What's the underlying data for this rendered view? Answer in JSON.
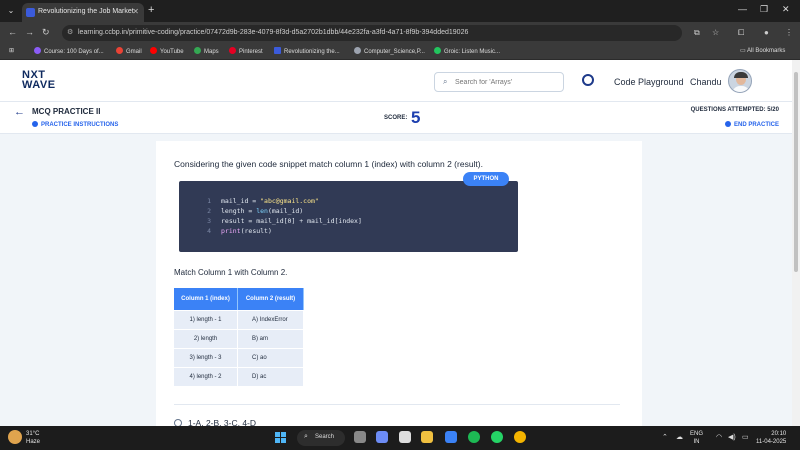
{
  "browser": {
    "tab_title": "Revolutionizing the Job Market",
    "url": "learning.ccbp.in/primitive-coding/practice/07472d9b-283e-4079-8f3d-d5a2702b1dbb/44e232fa-a3fd-4a71-8f9b-394dded19026",
    "bookmarks": [
      {
        "label": "Course: 100 Days of...",
        "color": "#8b5cf6"
      },
      {
        "label": "Gmail",
        "color": "#ea4335"
      },
      {
        "label": "YouTube",
        "color": "#ff0000"
      },
      {
        "label": "Maps",
        "color": "#34a853"
      },
      {
        "label": "Pinterest",
        "color": "#e60023"
      },
      {
        "label": "Revolutionizing the...",
        "color": "#3b5bdb"
      },
      {
        "label": "Computer_Science,P...",
        "color": "#9ca3af"
      },
      {
        "label": "Groic: Listen Music...",
        "color": "#22c55e"
      }
    ],
    "all_bookmarks": "All Bookmarks"
  },
  "header": {
    "logo_line1": "NXT",
    "logo_line2": "WAVE",
    "search_placeholder": "Search for 'Arrays'",
    "code_playground": "Code Playground",
    "user_name": "Chandu"
  },
  "practice": {
    "title": "MCQ PRACTICE II",
    "instructions": "PRACTICE INSTRUCTIONS",
    "score_label": "SCORE:",
    "score": "5",
    "attempted": "QUESTIONS ATTEMPTED: 5/20",
    "end": "END PRACTICE"
  },
  "question": {
    "text": "Considering the given code snippet match column 1 (index) with column 2 (result).",
    "language": "PYTHON",
    "code_lines": [
      {
        "num": "1",
        "parts": [
          {
            "t": "mail_id = ",
            "c": ""
          },
          {
            "t": "\"abc@gmail.com\"",
            "c": "str"
          }
        ]
      },
      {
        "num": "2",
        "parts": [
          {
            "t": "length = ",
            "c": ""
          },
          {
            "t": "len",
            "c": "fn"
          },
          {
            "t": "(mail_id)",
            "c": ""
          }
        ]
      },
      {
        "num": "3",
        "parts": [
          {
            "t": "result = mail_id[0] + mail_id[index]",
            "c": ""
          }
        ]
      },
      {
        "num": "4",
        "parts": [
          {
            "t": "print",
            "c": "kw"
          },
          {
            "t": "(result)",
            "c": ""
          }
        ]
      }
    ],
    "match_heading": "Match Column 1 with Column 2.",
    "table_headers": [
      "Column 1 (index)",
      "Column 2 (result)"
    ],
    "table_rows": [
      [
        "1) length - 1",
        "A) IndexError"
      ],
      [
        "2) length",
        "B) am"
      ],
      [
        "3) length - 3",
        "C) ao"
      ],
      [
        "4) length - 2",
        "D) ac"
      ]
    ],
    "option_1": "1-A, 2-B, 3-C, 4-D"
  },
  "taskbar": {
    "temp": "31°C",
    "weather": "Haze",
    "search": "Search",
    "lang_1": "ENG",
    "lang_2": "IN",
    "time": "20:10",
    "date": "11-04-2025",
    "notification_count": "9"
  }
}
